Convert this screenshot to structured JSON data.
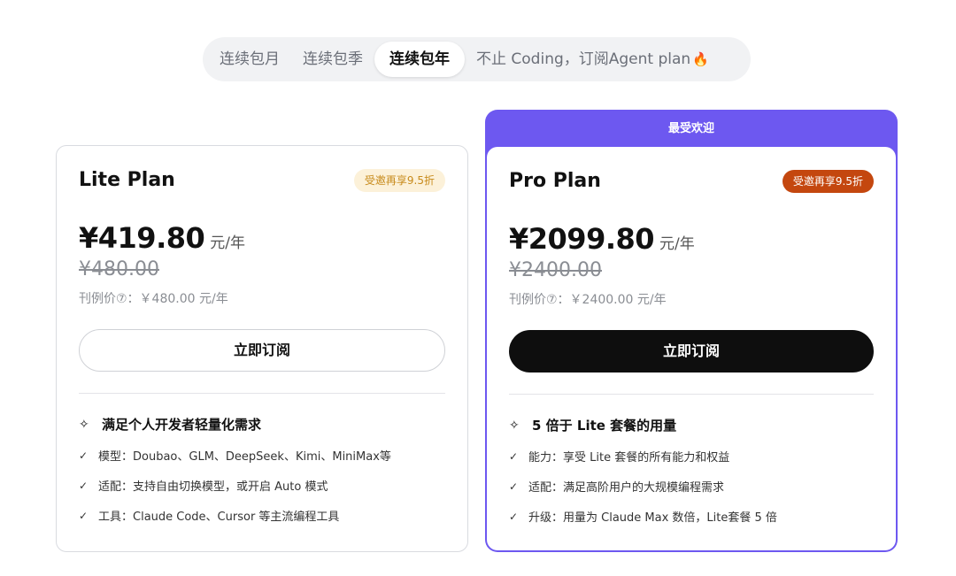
{
  "tabs": [
    {
      "label": "连续包月",
      "active": false
    },
    {
      "label": "连续包季",
      "active": false
    },
    {
      "label": "连续包年",
      "active": true
    },
    {
      "label": "不止 Coding，订阅Agent plan",
      "active": false
    }
  ],
  "lite": {
    "name": "Lite Plan",
    "badge": "受邀再享9.5折",
    "price": "¥419.80",
    "unit": "元/年",
    "original": "¥480.00",
    "list_price": "刊例价⑦：￥480.00 元/年",
    "button": "立即订阅",
    "feature_title": "满足个人开发者轻量化需求",
    "features": [
      "模型：Doubao、GLM、DeepSeek、Kimi、MiniMax等",
      "适配：支持自由切换模型，或开启 Auto 模式",
      "工具：Claude Code、Cursor 等主流编程工具"
    ]
  },
  "pro": {
    "popular": "最受欢迎",
    "name": "Pro Plan",
    "badge": "受邀再享9.5折",
    "price": "¥2099.80",
    "unit": "元/年",
    "original": "¥2400.00",
    "list_price": "刊例价⑦：￥2400.00 元/年",
    "button": "立即订阅",
    "feature_title": "5 倍于 Lite 套餐的用量",
    "features": [
      "能力：享受 Lite 套餐的所有能力和权益",
      "适配：满足高阶用户的大规模编程需求",
      "升级：用量为 Claude Max 数倍，Lite套餐 5 倍"
    ]
  },
  "icons": {
    "flame": "🔥",
    "sparkle": "✧",
    "check": "✓"
  },
  "colors": {
    "accent": "#6d58f0",
    "badge_light_bg": "#fcf1d9",
    "badge_light_text": "#c78a1a",
    "badge_dark_bg": "#c4470f"
  }
}
